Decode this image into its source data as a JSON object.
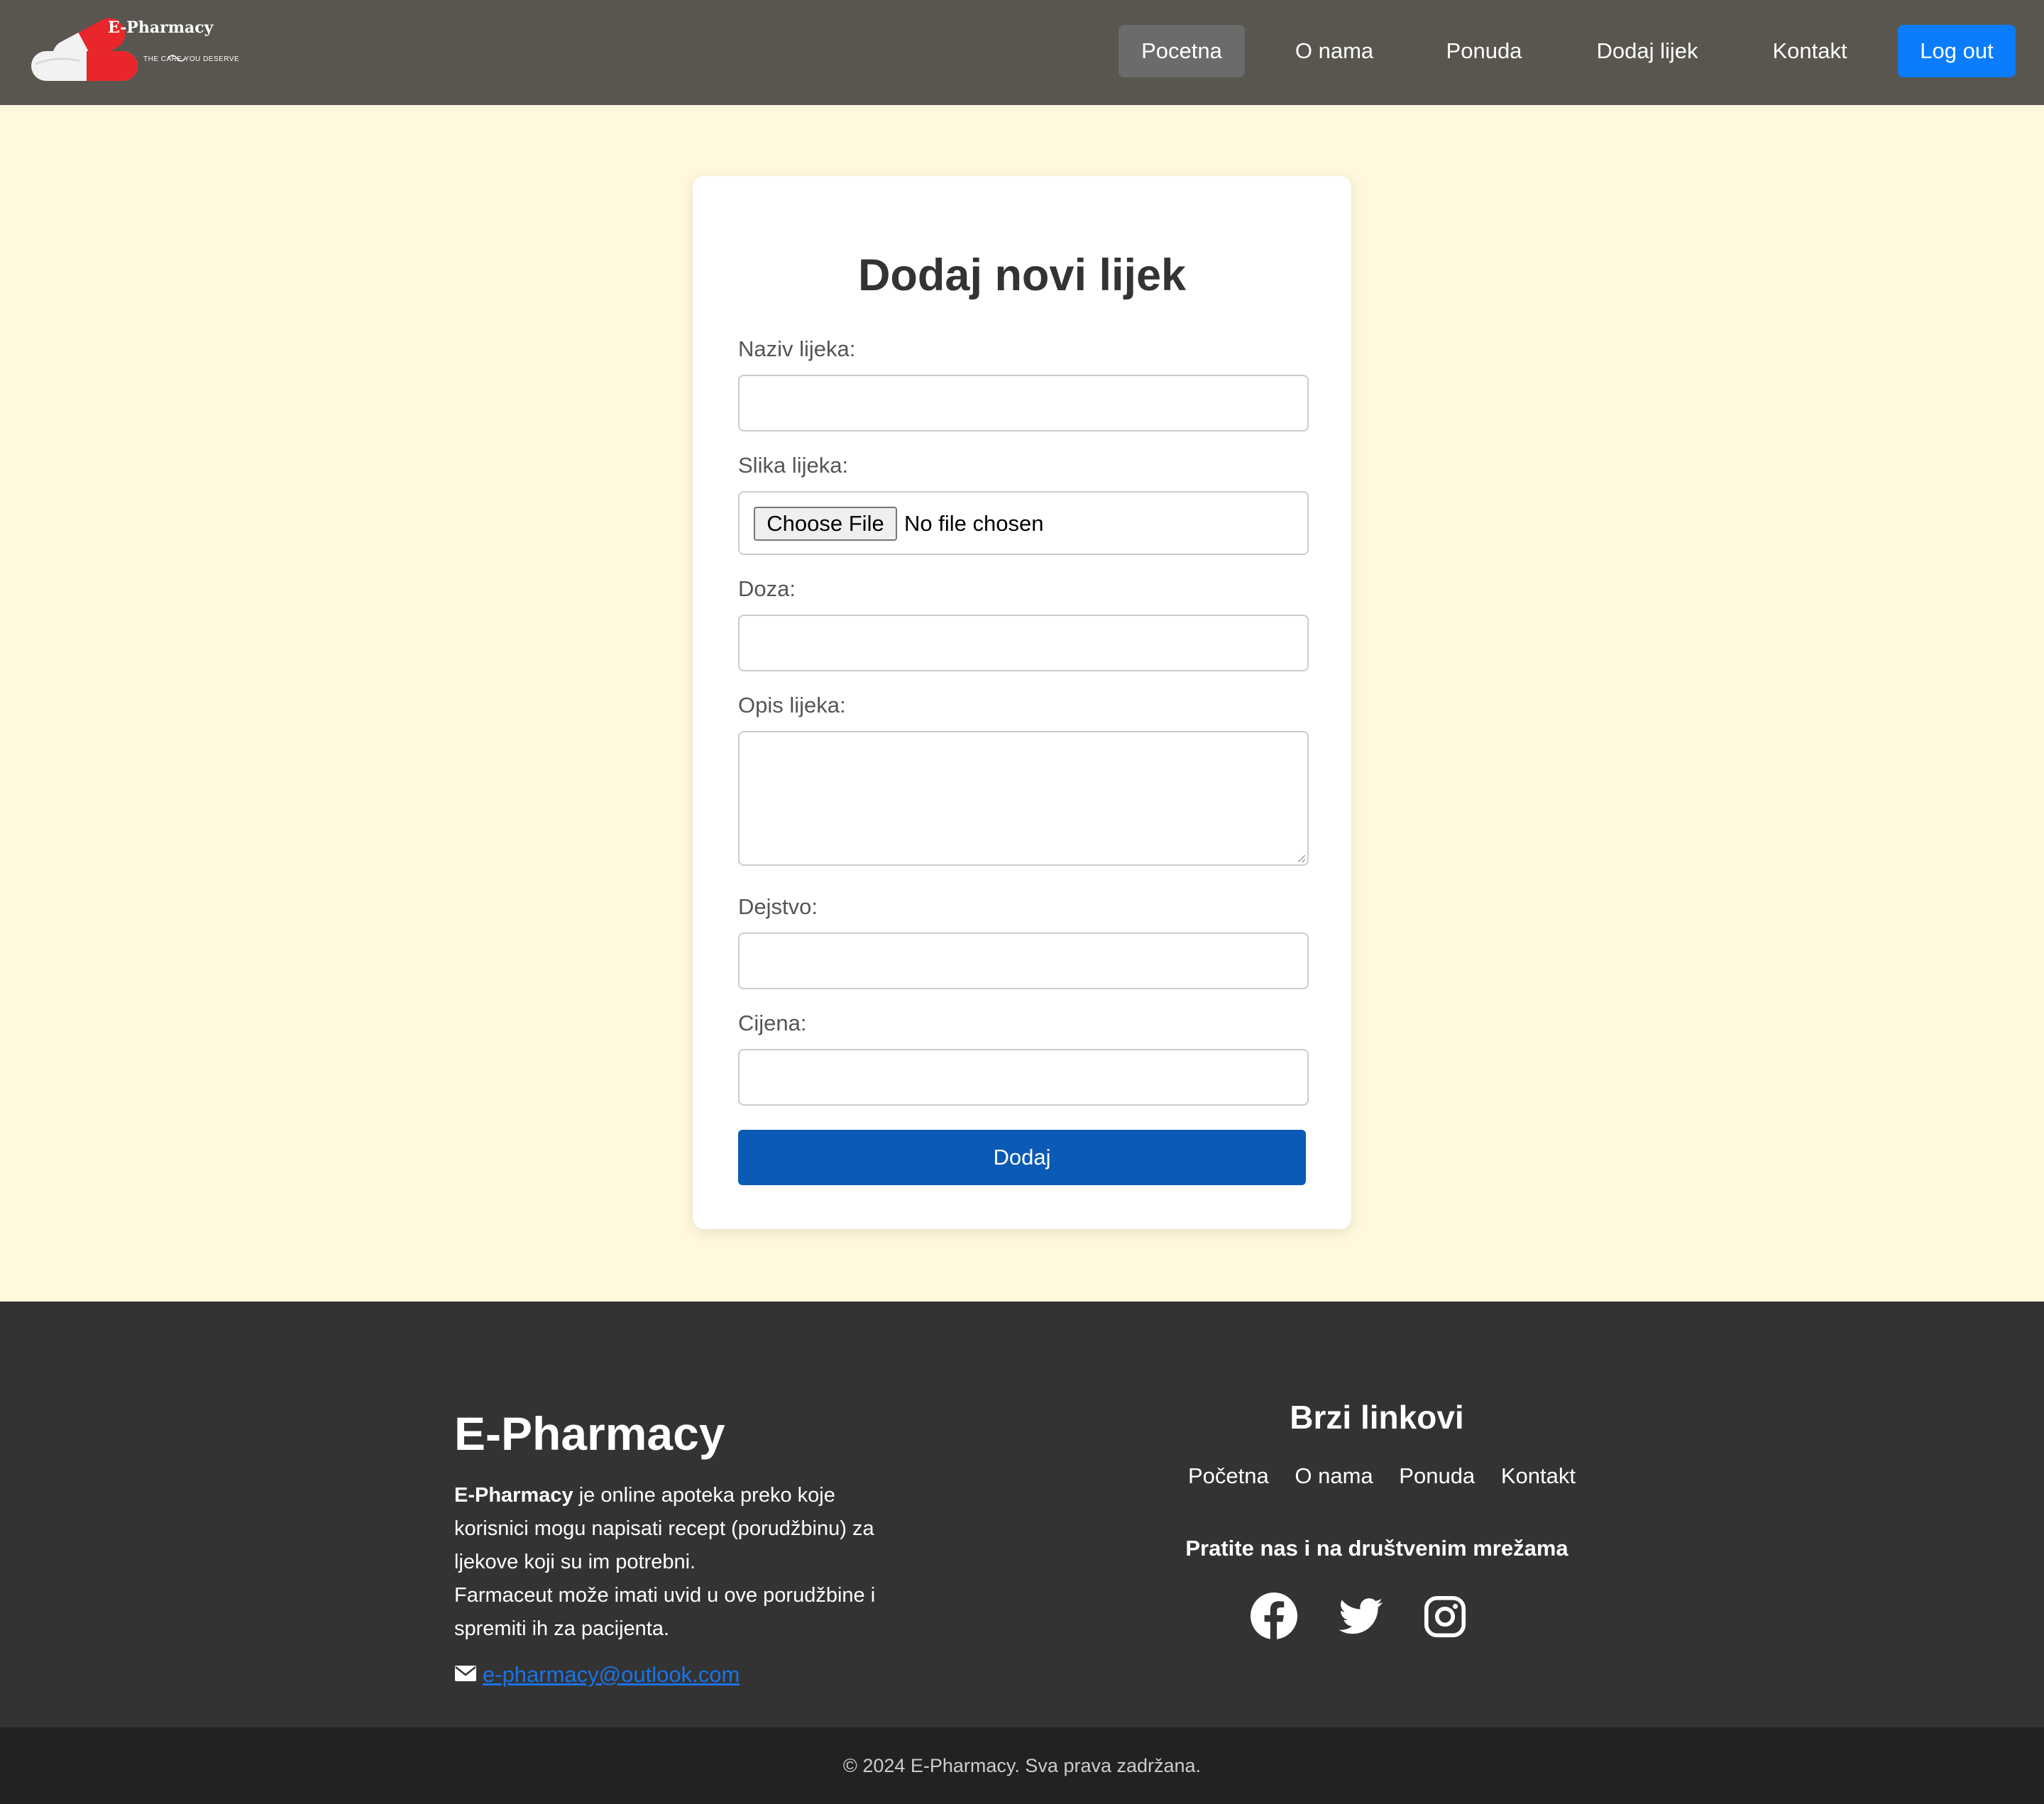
{
  "brand": {
    "name": "E-Pharmacy",
    "tagline": "THE CARE YOU DESERVE",
    "logo_colors": {
      "capsule_red": "#e8262b",
      "capsule_white": "#f2f2f2"
    }
  },
  "nav": {
    "items": [
      {
        "label": "Pocetna"
      },
      {
        "label": "O nama"
      },
      {
        "label": "Ponuda"
      },
      {
        "label": "Dodaj lijek"
      },
      {
        "label": "Kontakt"
      }
    ],
    "active_item": "Pocetna",
    "logout_label": "Log out"
  },
  "form": {
    "title": "Dodaj novi lijek",
    "fields": {
      "naziv": {
        "label": "Naziv lijeka:",
        "value": ""
      },
      "slika": {
        "label": "Slika lijeka:",
        "button_label": "Choose File",
        "status": "No file chosen"
      },
      "doza": {
        "label": "Doza:",
        "value": ""
      },
      "opis": {
        "label": "Opis lijeka:",
        "value": ""
      },
      "dejstvo": {
        "label": "Dejstvo:",
        "value": ""
      },
      "cijena": {
        "label": "Cijena:",
        "value": ""
      }
    },
    "submit_label": "Dodaj"
  },
  "footer": {
    "brand": "E-Pharmacy",
    "description_strong": "E-Pharmacy",
    "description_rest": " je online apoteka preko koje korisnici mogu napisati recept (porudžbinu) za ljekove koji su im potrebni.",
    "description_line2": "Farmaceut može imati uvid u ove porudžbine i spremiti ih za pacijenta.",
    "email": "e-pharmacy@outlook.com",
    "quick_links_title": "Brzi linkovi",
    "quick_links": [
      "Početna",
      "O nama",
      "Ponuda",
      "Kontakt"
    ],
    "social_title": "Pratite nas i na društvenim mrežama",
    "social_icons": [
      "facebook-icon",
      "twitter-icon",
      "instagram-icon"
    ],
    "copyright": "© 2024 E-Pharmacy. Sva prava zadržana."
  },
  "colors": {
    "nav_bg": "#58564f",
    "page_bg": "#fff8dc",
    "logout_bg": "#0b7dfc",
    "submit_bg": "#0b5ab6",
    "footer_bg": "#333333",
    "bottom_bar_bg": "#222222",
    "link": "#1a73e8"
  }
}
